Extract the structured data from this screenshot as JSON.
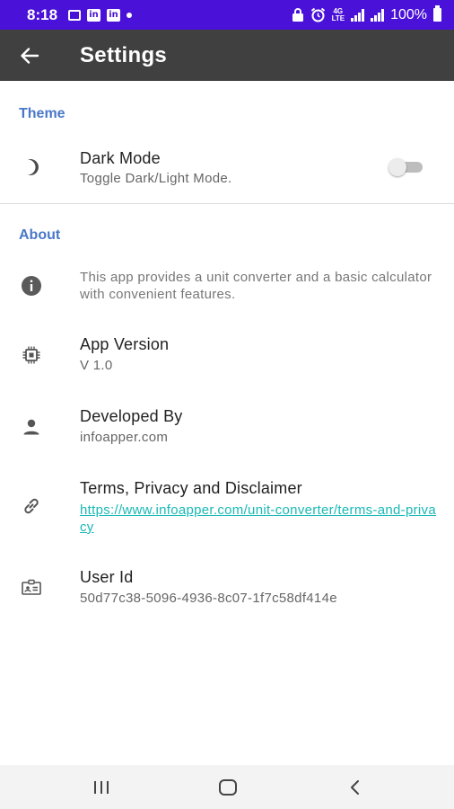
{
  "status_bar": {
    "time": "8:18",
    "battery": "100%",
    "left_icons": [
      "gallery-icon",
      "linkedin-icon",
      "linkedin-icon",
      "dot-icon"
    ],
    "right_icons": [
      "lock-icon",
      "alarm-icon",
      "4g-lte-icon",
      "signal-icon",
      "signal-icon",
      "battery-icon"
    ],
    "linkedin_glyph": "in",
    "network_label": "4G",
    "lte_label": "LTE",
    "background": "#4a12d8"
  },
  "app_bar": {
    "title": "Settings",
    "back_icon": "arrow-back-icon",
    "background": "#404040"
  },
  "sections": {
    "theme": {
      "header": "Theme",
      "dark_mode": {
        "icon": "moon-icon",
        "title": "Dark Mode",
        "subtitle": "Toggle Dark/Light Mode.",
        "enabled": false
      }
    },
    "about": {
      "header": "About",
      "description": {
        "icon": "info-icon",
        "text": "This app provides a unit converter and a basic calculator with convenient features."
      },
      "version": {
        "icon": "chip-icon",
        "title": "App Version",
        "value": "V 1.0"
      },
      "developer": {
        "icon": "person-icon",
        "title": "Developed By",
        "value": "infoapper.com"
      },
      "terms": {
        "icon": "link-icon",
        "title": "Terms, Privacy and Disclaimer",
        "link": "https://www.infoapper.com/unit-converter/terms-and-privacy"
      },
      "user_id": {
        "icon": "id-card-icon",
        "title": "User Id",
        "value": "50d77c38-5096-4936-8c07-1f7c58df414e"
      }
    }
  },
  "colors": {
    "section_header": "#4a78c8",
    "link": "#18b9b5"
  },
  "nav_bar": {
    "buttons": [
      "recent-apps-icon",
      "home-icon",
      "back-icon"
    ]
  }
}
